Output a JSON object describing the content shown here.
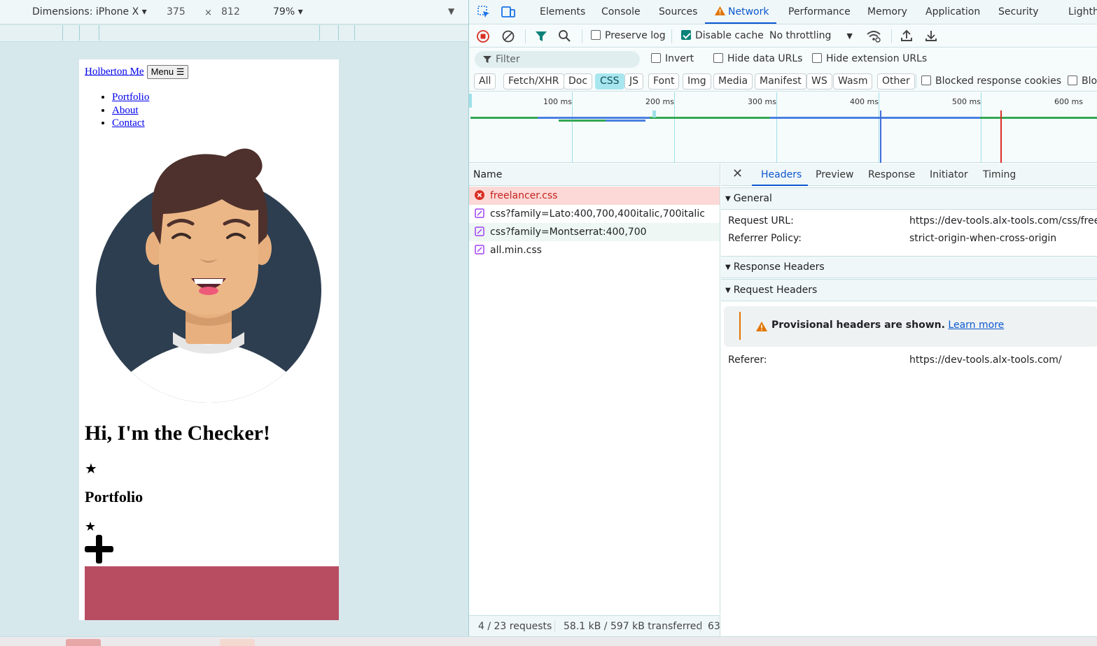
{
  "device_toolbar": {
    "dimensions_label": "Dimensions: iPhone X ▾",
    "width": "375",
    "times": "×",
    "height": "812",
    "zoom": "79% ▾",
    "more": "▼"
  },
  "page": {
    "logo_link": "Holberton Me",
    "menu_button": "Menu ☰",
    "nav_items": [
      "Portfolio",
      "About",
      "Contact"
    ],
    "heading": "Hi, I'm the Checker!",
    "star_glyph": "★",
    "portfolio_heading": "Portfolio",
    "block_color": "#b84d62"
  },
  "devtools": {
    "tabs": [
      "Elements",
      "Console",
      "Sources",
      "Network",
      "Performance",
      "Memory",
      "Application",
      "Security",
      "Lighth"
    ],
    "active_tab": "Network",
    "toolbar": {
      "preserve_log": "Preserve log",
      "disable_cache": "Disable cache",
      "throttling": "No throttling"
    },
    "filter": {
      "placeholder": "Filter",
      "invert": "Invert",
      "hide_data_urls": "Hide data URLs",
      "hide_extension_urls": "Hide extension URLs"
    },
    "type_filters": [
      "All",
      "Fetch/XHR",
      "Doc",
      "CSS",
      "JS",
      "Font",
      "Img",
      "Media",
      "Manifest",
      "WS",
      "Wasm",
      "Other"
    ],
    "active_type": "CSS",
    "blocked_cookies": "Blocked response cookies",
    "blocked_more": "Blo",
    "timeline_labels": [
      "100 ms",
      "200 ms",
      "300 ms",
      "400 ms",
      "500 ms",
      "600 ms"
    ],
    "name_header": "Name",
    "requests": [
      {
        "name": "freelancer.css",
        "status": "error"
      },
      {
        "name": "css?family=Lato:400,700,400italic,700italic",
        "status": "ok"
      },
      {
        "name": "css?family=Montserrat:400,700",
        "status": "ok"
      },
      {
        "name": "all.min.css",
        "status": "ok"
      }
    ],
    "status_bar": {
      "requests": "4 / 23 requests",
      "transferred": "58.1 kB / 597 kB transferred",
      "more": "63"
    },
    "detail": {
      "tabs": [
        "Headers",
        "Preview",
        "Response",
        "Initiator",
        "Timing"
      ],
      "active_tab": "Headers",
      "general": "General",
      "request_url_key": "Request URL:",
      "request_url_val": "https://dev-tools.alx-tools.com/css/freela",
      "referrer_policy_key": "Referrer Policy:",
      "referrer_policy_val": "strict-origin-when-cross-origin",
      "response_headers": "Response Headers",
      "request_headers": "Request Headers",
      "warning_bold": "Provisional headers are shown.",
      "warning_link": "Learn more",
      "referer_key": "Referer:",
      "referer_val": "https://dev-tools.alx-tools.com/"
    }
  },
  "colors": {
    "accent": "#0b57d0",
    "error": "#c5221f",
    "warning": "#e37400",
    "active_chip": "#a8e6ef"
  }
}
